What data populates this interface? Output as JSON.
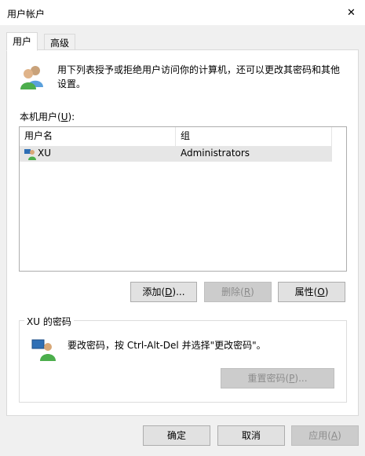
{
  "window": {
    "title": "用户帐户",
    "close_symbol": "✕"
  },
  "tabs": [
    {
      "label": "用户"
    },
    {
      "label": "高级"
    }
  ],
  "intro": {
    "text": "用下列表授予或拒绝用户访问你的计算机，还可以更改其密码和其他设置。"
  },
  "local_users": {
    "label": "本机用户(",
    "hotkey": "U",
    "label_end": "):",
    "columns": [
      "用户名",
      "组"
    ],
    "rows": [
      {
        "name": "XU",
        "group": "Administrators"
      }
    ]
  },
  "actions": {
    "add": {
      "label": "添加(",
      "hotkey": "D",
      "end": ")..."
    },
    "remove": {
      "label": "删除(",
      "hotkey": "R",
      "end": ")"
    },
    "properties": {
      "label": "属性(",
      "hotkey": "O",
      "end": ")"
    }
  },
  "password_group": {
    "title": "XU 的密码",
    "text": "要改密码，按 Ctrl-Alt-Del 并选择\"更改密码\"。",
    "reset": {
      "label": "重置密码(",
      "hotkey": "P",
      "end": ")..."
    }
  },
  "footer": {
    "ok": {
      "label": "确定"
    },
    "cancel": {
      "label": "取消"
    },
    "apply": {
      "label": "应用(",
      "hotkey": "A",
      "end": ")"
    }
  },
  "colors": {
    "selected_row": "#e6e6e6",
    "disabled_text": "#8c8c8c",
    "window_bg": "#f0f0f0"
  },
  "icons": {
    "users": "users-icon",
    "user_row": "user-icon",
    "password": "password-icon",
    "close": "close-icon"
  }
}
